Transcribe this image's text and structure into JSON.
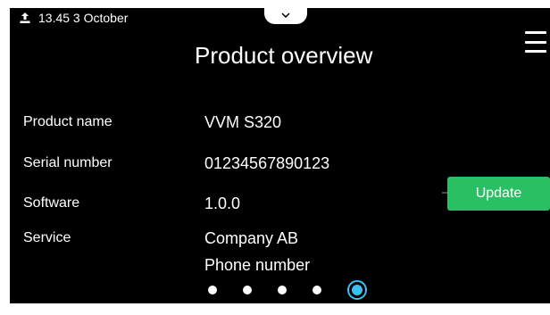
{
  "status_bar": {
    "datetime": "13.45 3 October",
    "icon": "usb-upload-icon"
  },
  "header": {
    "title": "Product overview",
    "pull_tab_icon": "chevron-down-icon",
    "menu_icon": "hamburger-menu-icon"
  },
  "rows": [
    {
      "label": "Product name",
      "value": "VVM S320"
    },
    {
      "label": "Serial number",
      "value": "01234567890123"
    },
    {
      "label": "Software",
      "value": "1.0.0"
    },
    {
      "label": "Service",
      "value": "Company AB",
      "value2": "Phone number"
    }
  ],
  "update_button": {
    "label": "Update"
  },
  "pager": {
    "count": 5,
    "active_index": 4
  },
  "colors": {
    "background": "#000000",
    "text": "#ffffff",
    "update_button": "#28c063",
    "active_dot": "#3dc0f0"
  }
}
